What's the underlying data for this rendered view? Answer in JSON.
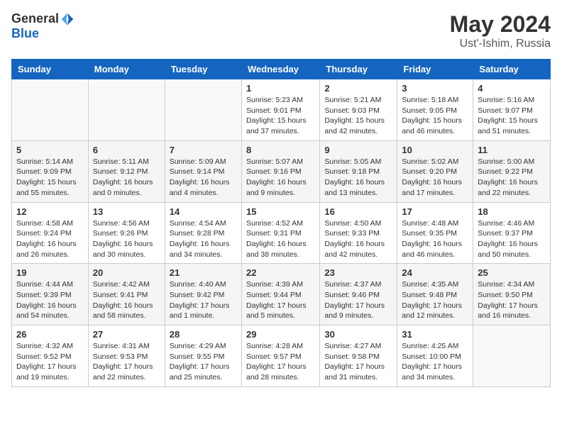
{
  "logo": {
    "general": "General",
    "blue": "Blue"
  },
  "title": {
    "month_year": "May 2024",
    "location": "Ust'-Ishim, Russia"
  },
  "days_of_week": [
    "Sunday",
    "Monday",
    "Tuesday",
    "Wednesday",
    "Thursday",
    "Friday",
    "Saturday"
  ],
  "weeks": [
    [
      {
        "day": "",
        "info": ""
      },
      {
        "day": "",
        "info": ""
      },
      {
        "day": "",
        "info": ""
      },
      {
        "day": "1",
        "info": "Sunrise: 5:23 AM\nSunset: 9:01 PM\nDaylight: 15 hours and 37 minutes."
      },
      {
        "day": "2",
        "info": "Sunrise: 5:21 AM\nSunset: 9:03 PM\nDaylight: 15 hours and 42 minutes."
      },
      {
        "day": "3",
        "info": "Sunrise: 5:18 AM\nSunset: 9:05 PM\nDaylight: 15 hours and 46 minutes."
      },
      {
        "day": "4",
        "info": "Sunrise: 5:16 AM\nSunset: 9:07 PM\nDaylight: 15 hours and 51 minutes."
      }
    ],
    [
      {
        "day": "5",
        "info": "Sunrise: 5:14 AM\nSunset: 9:09 PM\nDaylight: 15 hours and 55 minutes."
      },
      {
        "day": "6",
        "info": "Sunrise: 5:11 AM\nSunset: 9:12 PM\nDaylight: 16 hours and 0 minutes."
      },
      {
        "day": "7",
        "info": "Sunrise: 5:09 AM\nSunset: 9:14 PM\nDaylight: 16 hours and 4 minutes."
      },
      {
        "day": "8",
        "info": "Sunrise: 5:07 AM\nSunset: 9:16 PM\nDaylight: 16 hours and 9 minutes."
      },
      {
        "day": "9",
        "info": "Sunrise: 5:05 AM\nSunset: 9:18 PM\nDaylight: 16 hours and 13 minutes."
      },
      {
        "day": "10",
        "info": "Sunrise: 5:02 AM\nSunset: 9:20 PM\nDaylight: 16 hours and 17 minutes."
      },
      {
        "day": "11",
        "info": "Sunrise: 5:00 AM\nSunset: 9:22 PM\nDaylight: 16 hours and 22 minutes."
      }
    ],
    [
      {
        "day": "12",
        "info": "Sunrise: 4:58 AM\nSunset: 9:24 PM\nDaylight: 16 hours and 26 minutes."
      },
      {
        "day": "13",
        "info": "Sunrise: 4:56 AM\nSunset: 9:26 PM\nDaylight: 16 hours and 30 minutes."
      },
      {
        "day": "14",
        "info": "Sunrise: 4:54 AM\nSunset: 9:28 PM\nDaylight: 16 hours and 34 minutes."
      },
      {
        "day": "15",
        "info": "Sunrise: 4:52 AM\nSunset: 9:31 PM\nDaylight: 16 hours and 38 minutes."
      },
      {
        "day": "16",
        "info": "Sunrise: 4:50 AM\nSunset: 9:33 PM\nDaylight: 16 hours and 42 minutes."
      },
      {
        "day": "17",
        "info": "Sunrise: 4:48 AM\nSunset: 9:35 PM\nDaylight: 16 hours and 46 minutes."
      },
      {
        "day": "18",
        "info": "Sunrise: 4:46 AM\nSunset: 9:37 PM\nDaylight: 16 hours and 50 minutes."
      }
    ],
    [
      {
        "day": "19",
        "info": "Sunrise: 4:44 AM\nSunset: 9:39 PM\nDaylight: 16 hours and 54 minutes."
      },
      {
        "day": "20",
        "info": "Sunrise: 4:42 AM\nSunset: 9:41 PM\nDaylight: 16 hours and 58 minutes."
      },
      {
        "day": "21",
        "info": "Sunrise: 4:40 AM\nSunset: 9:42 PM\nDaylight: 17 hours and 1 minute."
      },
      {
        "day": "22",
        "info": "Sunrise: 4:39 AM\nSunset: 9:44 PM\nDaylight: 17 hours and 5 minutes."
      },
      {
        "day": "23",
        "info": "Sunrise: 4:37 AM\nSunset: 9:46 PM\nDaylight: 17 hours and 9 minutes."
      },
      {
        "day": "24",
        "info": "Sunrise: 4:35 AM\nSunset: 9:48 PM\nDaylight: 17 hours and 12 minutes."
      },
      {
        "day": "25",
        "info": "Sunrise: 4:34 AM\nSunset: 9:50 PM\nDaylight: 17 hours and 16 minutes."
      }
    ],
    [
      {
        "day": "26",
        "info": "Sunrise: 4:32 AM\nSunset: 9:52 PM\nDaylight: 17 hours and 19 minutes."
      },
      {
        "day": "27",
        "info": "Sunrise: 4:31 AM\nSunset: 9:53 PM\nDaylight: 17 hours and 22 minutes."
      },
      {
        "day": "28",
        "info": "Sunrise: 4:29 AM\nSunset: 9:55 PM\nDaylight: 17 hours and 25 minutes."
      },
      {
        "day": "29",
        "info": "Sunrise: 4:28 AM\nSunset: 9:57 PM\nDaylight: 17 hours and 28 minutes."
      },
      {
        "day": "30",
        "info": "Sunrise: 4:27 AM\nSunset: 9:58 PM\nDaylight: 17 hours and 31 minutes."
      },
      {
        "day": "31",
        "info": "Sunrise: 4:25 AM\nSunset: 10:00 PM\nDaylight: 17 hours and 34 minutes."
      },
      {
        "day": "",
        "info": ""
      }
    ]
  ]
}
